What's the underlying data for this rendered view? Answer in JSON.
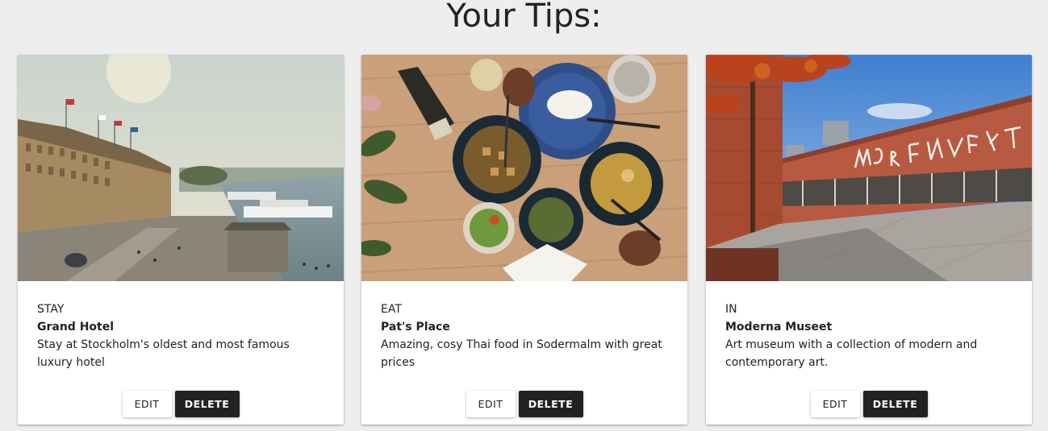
{
  "page": {
    "title": "Your Tips:"
  },
  "cards": [
    {
      "image_alt": "Grand Hotel waterfront view",
      "category": "STAY",
      "title": "Grand Hotel",
      "description": "Stay at Stockholm's oldest and most famous luxury hotel",
      "edit_label": "EDIT",
      "delete_label": "DELETE"
    },
    {
      "image_alt": "Thai food dishes on a table",
      "category": "EAT",
      "title": "Pat's Place",
      "description": "Amazing, cosy Thai food in Sodermalm with great prices",
      "edit_label": "EDIT",
      "delete_label": "DELETE"
    },
    {
      "image_alt": "Moderna Museet building exterior",
      "category": "IN",
      "title": "Moderna Museet",
      "description": "Art museum with a collection of modern and contemporary art.",
      "edit_label": "EDIT",
      "delete_label": "DELETE"
    }
  ],
  "colors": {
    "background": "#eeeeee",
    "card": "#ffffff",
    "delete_button": "#222222",
    "text": "#222222"
  }
}
